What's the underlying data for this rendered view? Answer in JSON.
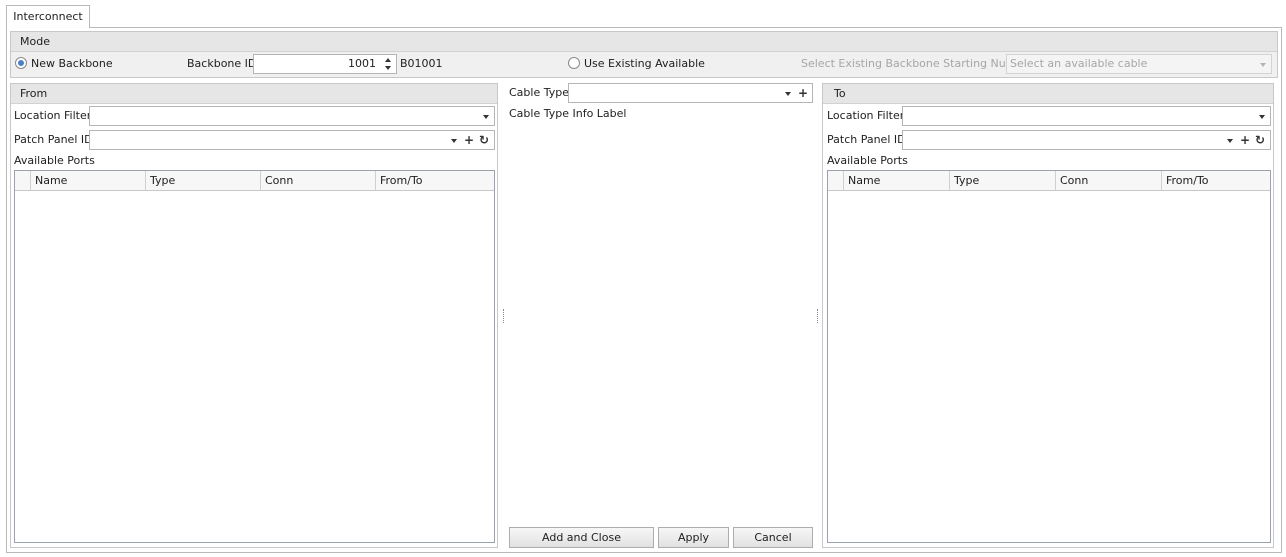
{
  "tab": {
    "label": "Interconnect"
  },
  "mode": {
    "title": "Mode",
    "new_backbone": "New Backbone",
    "backbone_id_label": "Backbone ID",
    "backbone_id_value": "1001",
    "backbone_code": "B01001",
    "use_existing": "Use Existing Available",
    "select_existing_label": "Select Existing Backbone Starting Number",
    "select_existing_placeholder": "Select an available cable"
  },
  "from": {
    "title": "From",
    "location_filter": "Location Filter",
    "patch_panel_id": "Patch Panel ID",
    "available_ports": "Available Ports",
    "columns": [
      "Name",
      "Type",
      "Conn",
      "From/To"
    ]
  },
  "middle": {
    "cable_type": "Cable Type",
    "info_label": "Cable Type Info Label",
    "add_close": "Add and Close",
    "apply": "Apply",
    "cancel": "Cancel"
  },
  "to": {
    "title": "To",
    "location_filter": "Location Filter",
    "patch_panel_id": "Patch Panel ID",
    "available_ports": "Available Ports",
    "columns": [
      "Name",
      "Type",
      "Conn",
      "From/To"
    ]
  },
  "icons": {
    "add": "+",
    "refresh": "↻"
  }
}
